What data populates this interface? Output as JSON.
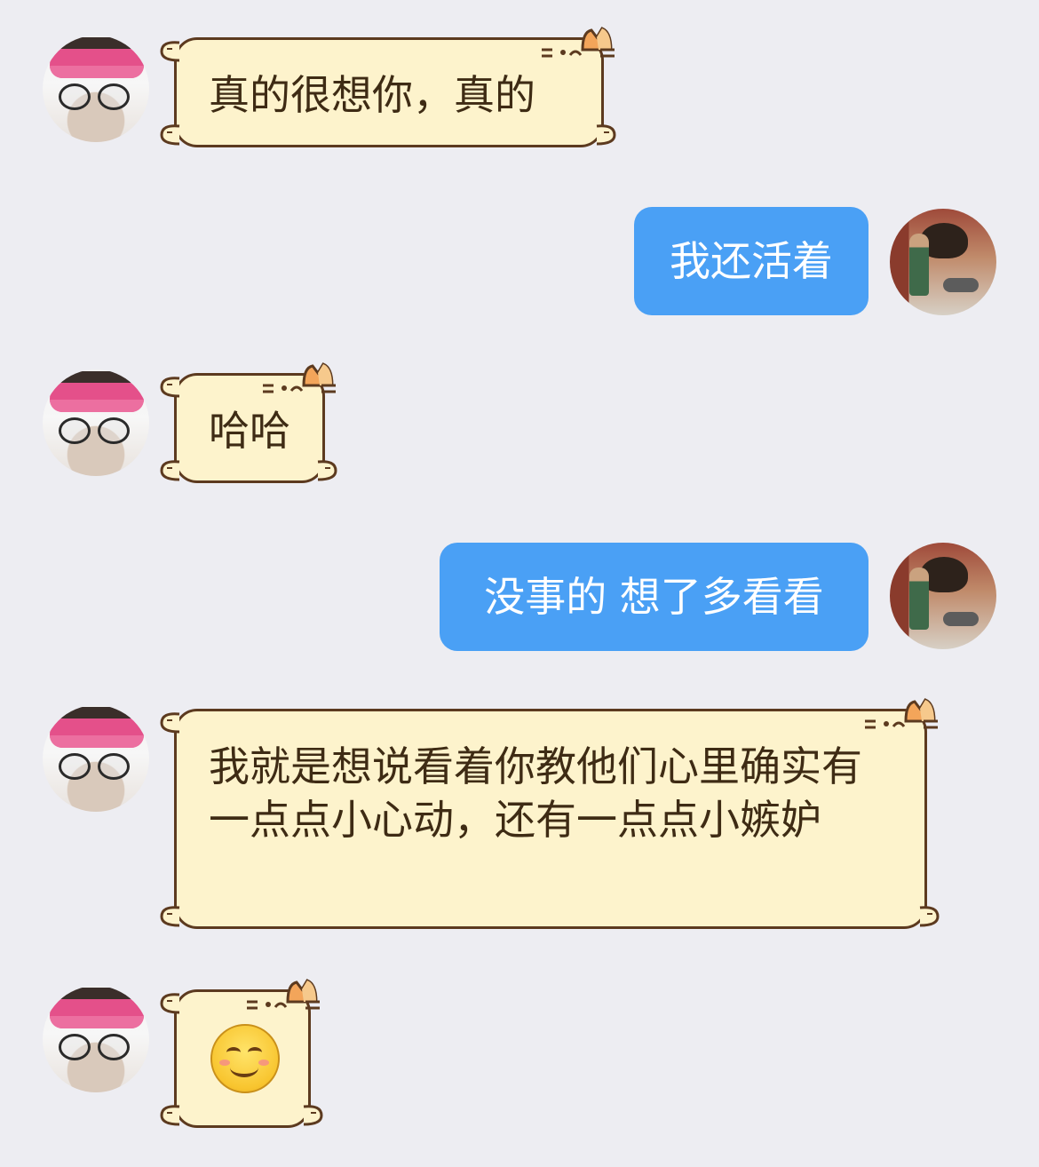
{
  "messages": [
    {
      "side": "incoming",
      "text": "真的很想你，真的"
    },
    {
      "side": "outgoing",
      "text": "我还活着"
    },
    {
      "side": "incoming",
      "text": "哈哈"
    },
    {
      "side": "outgoing",
      "text": "没事的 想了多看看"
    },
    {
      "side": "incoming",
      "text": "我就是想说看着你教他们心里确实有一点点小心动，还有一点点小嫉妒"
    },
    {
      "side": "incoming",
      "emoji": "smiling-face-with-smiling-eyes"
    }
  ],
  "colors": {
    "background": "#ededf2",
    "incoming_bubble": "#fdf3cc",
    "incoming_border": "#5c3a1f",
    "outgoing_bubble": "#4aa0f5"
  }
}
